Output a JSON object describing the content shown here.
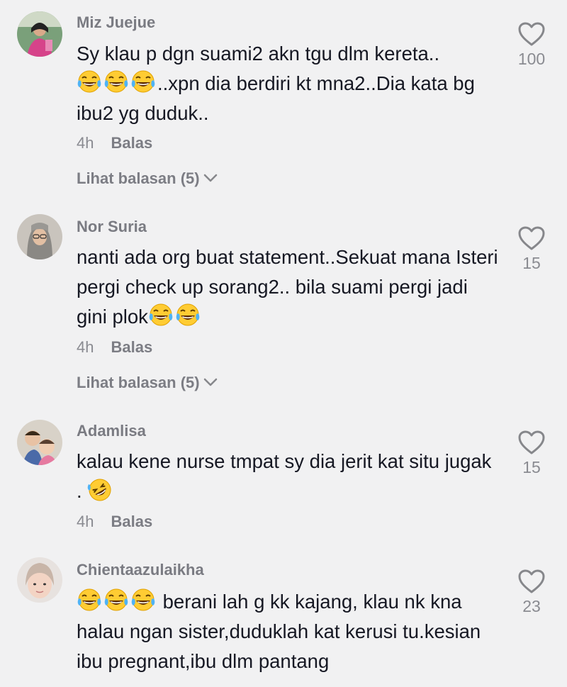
{
  "comments": [
    {
      "username": "Miz Juejue",
      "lines_before_emoji": "Sy klau p dgn suami2 akn tgu dlm kereta..",
      "text_after_emoji": "..xpn dia berdiri kt mna2..Dia kata bg ibu2 yg duduk..",
      "emoji_icon": "face-with-tears-of-joy-icon",
      "time": "4h",
      "reply_label": "Balas",
      "view_replies": "Lihat balasan (5)",
      "likes": "100"
    },
    {
      "username": "Nor Suria",
      "text": "nanti ada org buat statement..Sekuat mana Isteri pergi check up sorang2.. bila suami pergi jadi gini plok",
      "emoji_icon": "face-with-tears-of-joy-icon",
      "time": "4h",
      "reply_label": "Balas",
      "view_replies": "Lihat balasan (5)",
      "likes": "15"
    },
    {
      "username": "Adamlisa",
      "text": "kalau kene nurse tmpat sy dia jerit kat situ jugak .",
      "emoji_icon": "rolling-on-floor-laughing-icon",
      "time": "4h",
      "reply_label": "Balas",
      "likes": "15"
    },
    {
      "username": "Chientaazulaikha",
      "text": "berani lah g kk kajang, klau nk kna halau ngan sister,duduklah kat kerusi tu.kesian ibu pregnant,ibu dlm pantang",
      "emoji_icon": "face-with-tears-of-joy-icon",
      "likes": "23"
    }
  ],
  "colors": {
    "background": "#f1f1f2",
    "text": "#161823",
    "secondary": "#8a8b91"
  }
}
